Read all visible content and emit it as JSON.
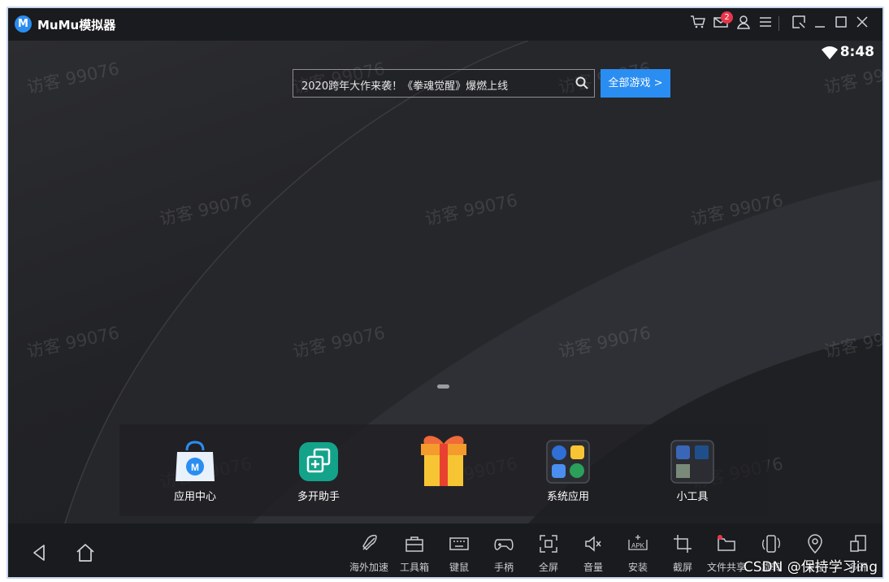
{
  "window": {
    "title": "MuMu模拟器",
    "logo_letter": "M",
    "mail_badge": "2"
  },
  "status": {
    "time": "8:48"
  },
  "search": {
    "text": "2020跨年大作来袭！《拳魂觉醒》爆燃上线",
    "button": "全部游戏 >"
  },
  "watermark": "访客 99076",
  "dock": {
    "items": [
      {
        "label": "应用中心"
      },
      {
        "label": "多开助手"
      },
      {
        "label": ""
      },
      {
        "label": "系统应用"
      },
      {
        "label": "小工具"
      }
    ]
  },
  "toolbar": {
    "items": [
      {
        "label": "海外加速",
        "icon": "rocket-icon"
      },
      {
        "label": "工具箱",
        "icon": "toolbox-icon"
      },
      {
        "label": "键鼠",
        "icon": "keyboard-icon"
      },
      {
        "label": "手柄",
        "icon": "gamepad-icon"
      },
      {
        "label": "全屏",
        "icon": "fullscreen-icon"
      },
      {
        "label": "音量",
        "icon": "volume-icon"
      },
      {
        "label": "安装",
        "icon": "apk-install-icon"
      },
      {
        "label": "截屏",
        "icon": "crop-icon"
      },
      {
        "label": "文件共享",
        "icon": "folder-icon"
      },
      {
        "label": "旋转",
        "icon": "rotate-icon"
      },
      {
        "label": "定位",
        "icon": "location-icon"
      },
      {
        "label": "多开",
        "icon": "multi-window-icon"
      }
    ]
  },
  "overlay": "CSDN @保持学习ing",
  "colors": {
    "accent": "#2a8df1",
    "badge": "#e8364a",
    "background": "#1d1e22"
  }
}
